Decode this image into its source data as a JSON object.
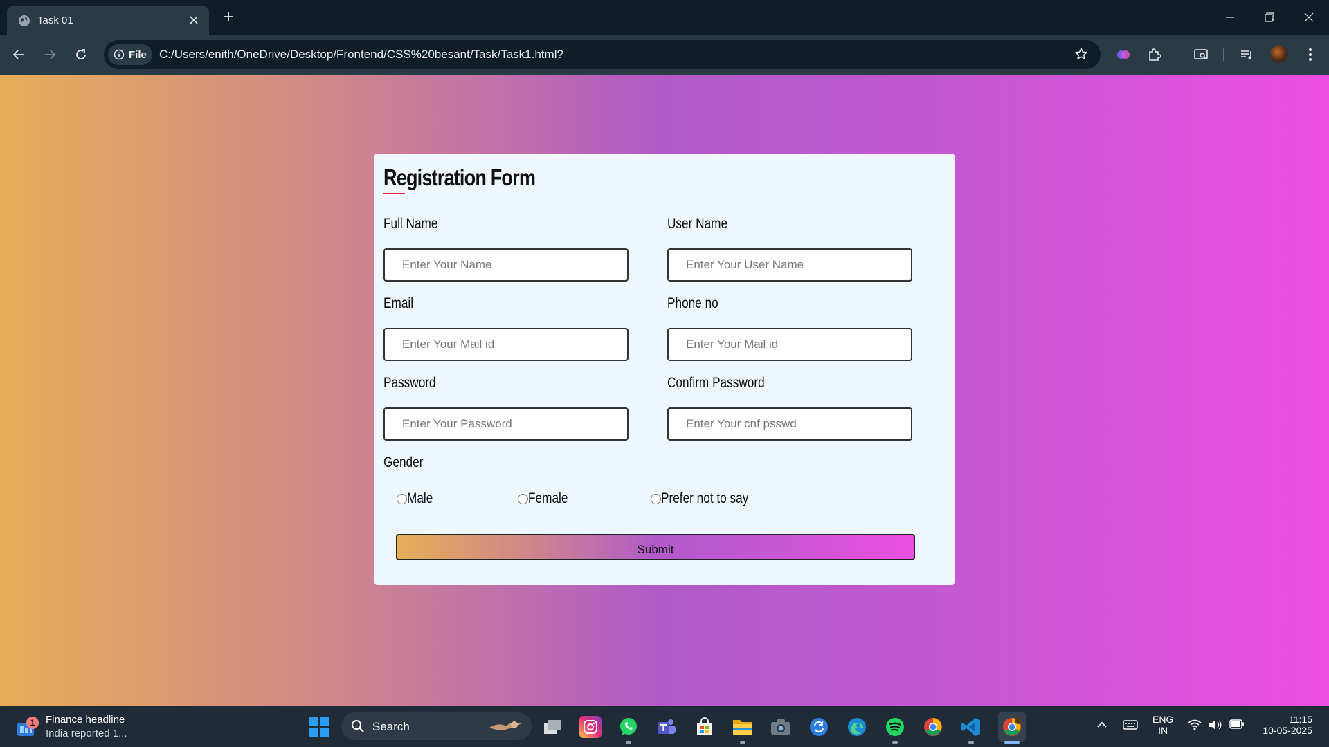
{
  "browser": {
    "tab_title": "Task 01",
    "site_chip": "File",
    "url": "C:/Users/enith/OneDrive/Desktop/Frontend/CSS%20besant/Task/Task1.html?"
  },
  "form": {
    "title": "Registration Form",
    "fields": [
      {
        "label": "Full Name",
        "placeholder": "Enter Your Name"
      },
      {
        "label": "User Name",
        "placeholder": "Enter Your User Name"
      },
      {
        "label": "Email",
        "placeholder": "Enter Your Mail id"
      },
      {
        "label": "Phone no",
        "placeholder": "Enter Your Mail id"
      },
      {
        "label": "Password",
        "placeholder": "Enter Your Password"
      },
      {
        "label": "Confirm Password",
        "placeholder": "Enter Your cnf psswd"
      }
    ],
    "gender_label": "Gender",
    "gender_options": [
      "Male",
      "Female",
      "Prefer not to say"
    ],
    "submit_label": "Submit"
  },
  "taskbar": {
    "news_badge": "1",
    "news_title": "Finance headline",
    "news_subtitle": "India reported 1...",
    "search_label": "Search",
    "language": "ENG",
    "region": "IN",
    "time": "11:15",
    "date": "10-05-2025"
  },
  "colors": {
    "gradient": [
      "#e6ae57",
      "#d0878a",
      "#b05ac9",
      "#c957d5",
      "#ec4ee2"
    ],
    "card_background": "#eef6fe",
    "title_accent": "#e0263d"
  }
}
